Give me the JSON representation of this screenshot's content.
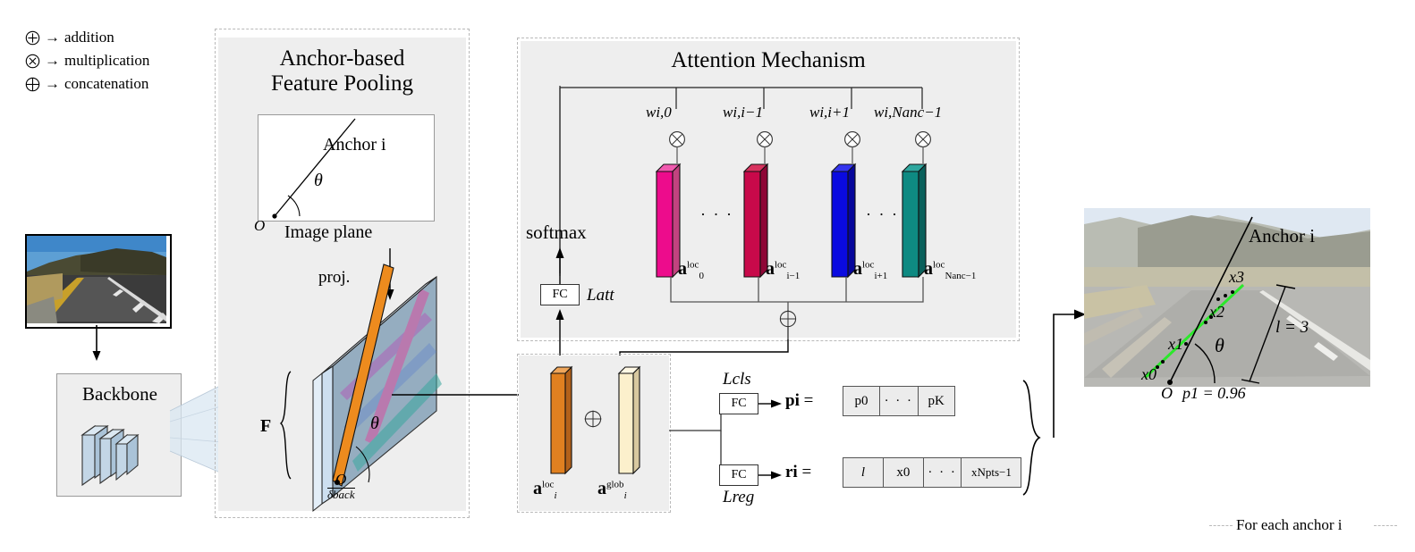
{
  "legend": {
    "items": [
      {
        "icon": "circle-plus-icon",
        "arrow": "→",
        "label": "addition"
      },
      {
        "icon": "circle-times-icon",
        "arrow": "→",
        "label": "multiplication"
      },
      {
        "icon": "circle-oplus-icon",
        "arrow": "→",
        "label": "concatenation"
      }
    ]
  },
  "pooling_panel": {
    "title_line1": "Anchor-based",
    "title_line2": "Feature Pooling",
    "anchor_label": "Anchor i",
    "theta": "θ",
    "origin": "O",
    "image_plane_label": "Image plane",
    "proj_label": "proj.",
    "feature_label": "F",
    "origin_fraction_num": "O",
    "origin_fraction_den": "δback"
  },
  "backbone": {
    "label": "Backbone"
  },
  "attention_panel": {
    "title": "Attention Mechanism",
    "softmax_label": "softmax",
    "fc_label": "FC",
    "loss_att": "Latt",
    "weights": [
      {
        "label": "wi,0"
      },
      {
        "label": "wi,i−1"
      },
      {
        "label": "wi,i+1"
      },
      {
        "label": "wi,Nanc−1"
      }
    ],
    "bars": [
      {
        "name": "a0loc",
        "color": "#ED0C8C",
        "label_base": "a",
        "label_sub": "0",
        "label_sup": "loc"
      },
      {
        "name": "ai-1loc",
        "color": "#C8094A",
        "label_base": "a",
        "label_sub": "i−1",
        "label_sup": "loc"
      },
      {
        "name": "ai+1loc",
        "color": "#0A0AE0",
        "label_base": "a",
        "label_sub": "i+1",
        "label_sup": "loc"
      },
      {
        "name": "aNloc",
        "color": "#0E8A82",
        "label_base": "a",
        "label_sub": "Nanc−1",
        "label_sup": "loc"
      }
    ],
    "ellipsis": "· · ·",
    "concat_icon": "circle-oplus-icon",
    "mult_icon": "circle-times-icon"
  },
  "fusion_panel": {
    "local_base": "a",
    "local_sub": "i",
    "local_sup": "loc",
    "local_color": "#E08020",
    "global_base": "a",
    "global_sub": "i",
    "global_sup": "glob",
    "global_color": "#FCF0CC",
    "concat_icon": "circle-oplus-icon"
  },
  "heads": {
    "cls_loss": "Lcls",
    "reg_loss": "Lreg",
    "fc_label": "FC",
    "cls_vector_name": "pi",
    "cls_vector_eq": "=",
    "cls_cells": [
      "p0",
      "· · ·",
      "pK"
    ],
    "reg_vector_name": "ri",
    "reg_vector_eq": "=",
    "reg_cells": [
      "l",
      "x0",
      "· · ·",
      "xNpts−1"
    ]
  },
  "result_image": {
    "anchor_label": "Anchor i",
    "points": [
      "x0",
      "x1",
      "x2",
      "x3"
    ],
    "ellipsis": "...",
    "theta": "θ",
    "length_label": "l = 3",
    "origin": "O",
    "prob_label": "p1 = 0.96"
  },
  "footer": {
    "caption": "For each anchor i"
  },
  "colors": {
    "panel_bg": "#eeeeee",
    "panel_border": "#b9b9b9",
    "line": "#000000"
  }
}
